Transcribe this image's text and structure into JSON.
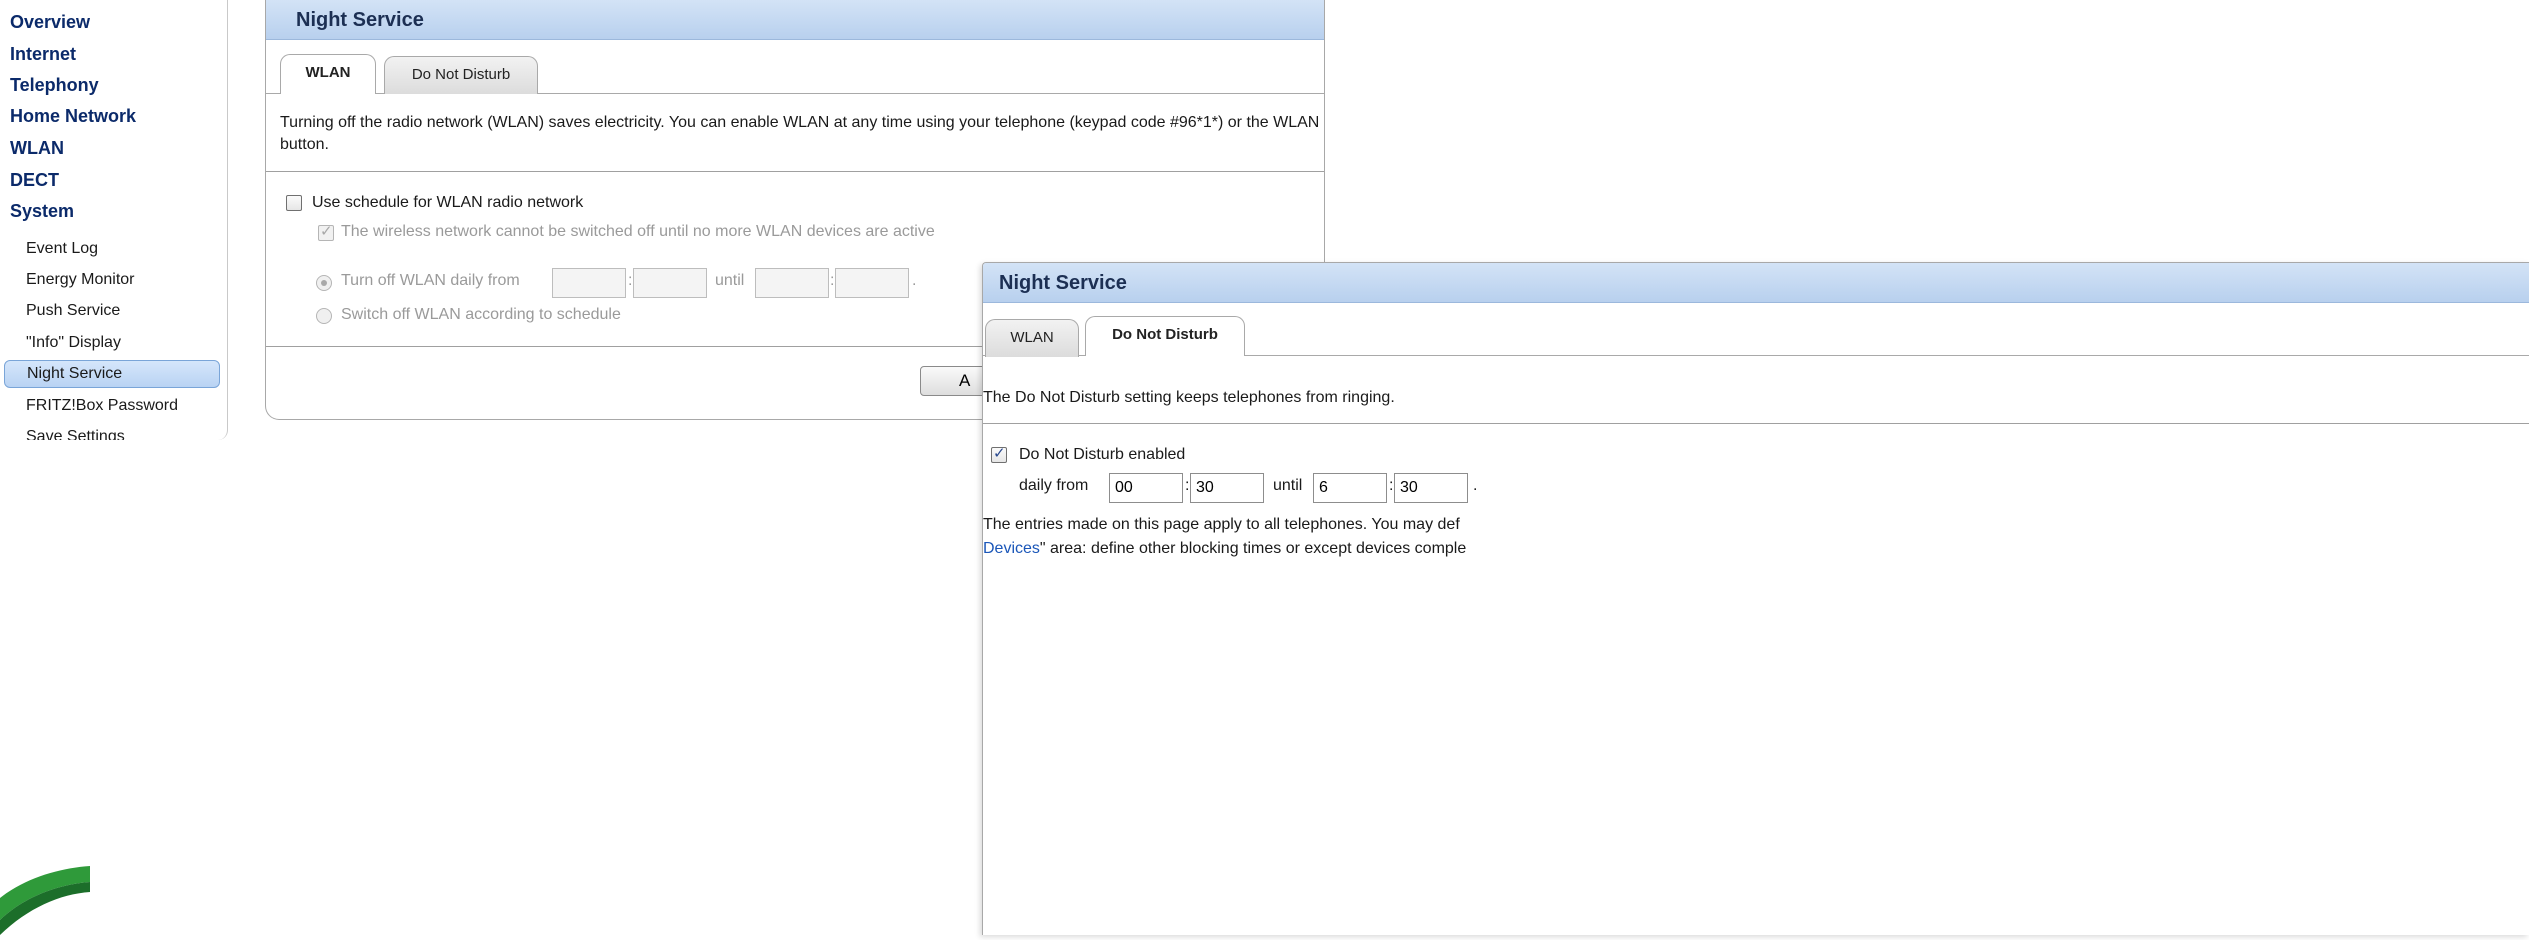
{
  "sidebar": {
    "main_items": [
      {
        "label": "Overview"
      },
      {
        "label": "Internet"
      },
      {
        "label": "Telephony"
      },
      {
        "label": "Home Network"
      },
      {
        "label": "WLAN"
      },
      {
        "label": "DECT"
      },
      {
        "label": "System"
      }
    ],
    "sub_items": [
      {
        "label": "Event Log"
      },
      {
        "label": "Energy Monitor"
      },
      {
        "label": "Push Service"
      },
      {
        "label": "\"Info\" Display"
      },
      {
        "label": "Night Service",
        "active": true
      },
      {
        "label": "FRITZ!Box Password"
      },
      {
        "label": "Save Settings"
      }
    ]
  },
  "wlan_panel": {
    "title": "Night Service",
    "tabs": [
      {
        "label": "WLAN",
        "active": true
      },
      {
        "label": "Do Not Disturb",
        "active": false
      }
    ],
    "description": "Turning off the radio network (WLAN) saves electricity. You can enable WLAN at any time using your telephone (keypad code #96*1*) or the WLAN button.",
    "use_schedule": {
      "label": "Use schedule for WLAN radio network",
      "checked": false
    },
    "wireless_note": {
      "label": "The wireless network cannot be switched off until no more WLAN devices are active",
      "checked": true,
      "disabled": true
    },
    "daily_option": {
      "label": "Turn off WLAN daily from",
      "until_label": "until",
      "selected": true,
      "disabled": true
    },
    "time_sep": ":",
    "end_dot": ".",
    "schedule_option": {
      "label": "Switch off WLAN according to schedule",
      "selected": false,
      "disabled": true
    },
    "apply_button": "A"
  },
  "dnd_panel": {
    "title": "Night Service",
    "tabs": [
      {
        "label": "WLAN",
        "active": false
      },
      {
        "label": "Do Not Disturb",
        "active": true
      }
    ],
    "description": "The Do Not Disturb setting keeps telephones from ringing.",
    "enabled": {
      "label": "Do Not Disturb enabled",
      "checked": true
    },
    "daily_from_label": "daily from",
    "until_label": "until",
    "time_sep": ":",
    "end_dot": ".",
    "from_hour": "00",
    "from_minute": "30",
    "until_hour": "6",
    "until_minute": "30",
    "note_line1": "The entries made on this page apply to all telephones. You may def",
    "note_link": "Devices",
    "note_line2_rest": "\" area: define other blocking times or except devices comple"
  },
  "colors": {
    "header_gradient_top": "#d3e3f6",
    "header_gradient_bottom": "#b8d0ee",
    "nav_text": "#0b2a6a",
    "link": "#1a56b8"
  }
}
